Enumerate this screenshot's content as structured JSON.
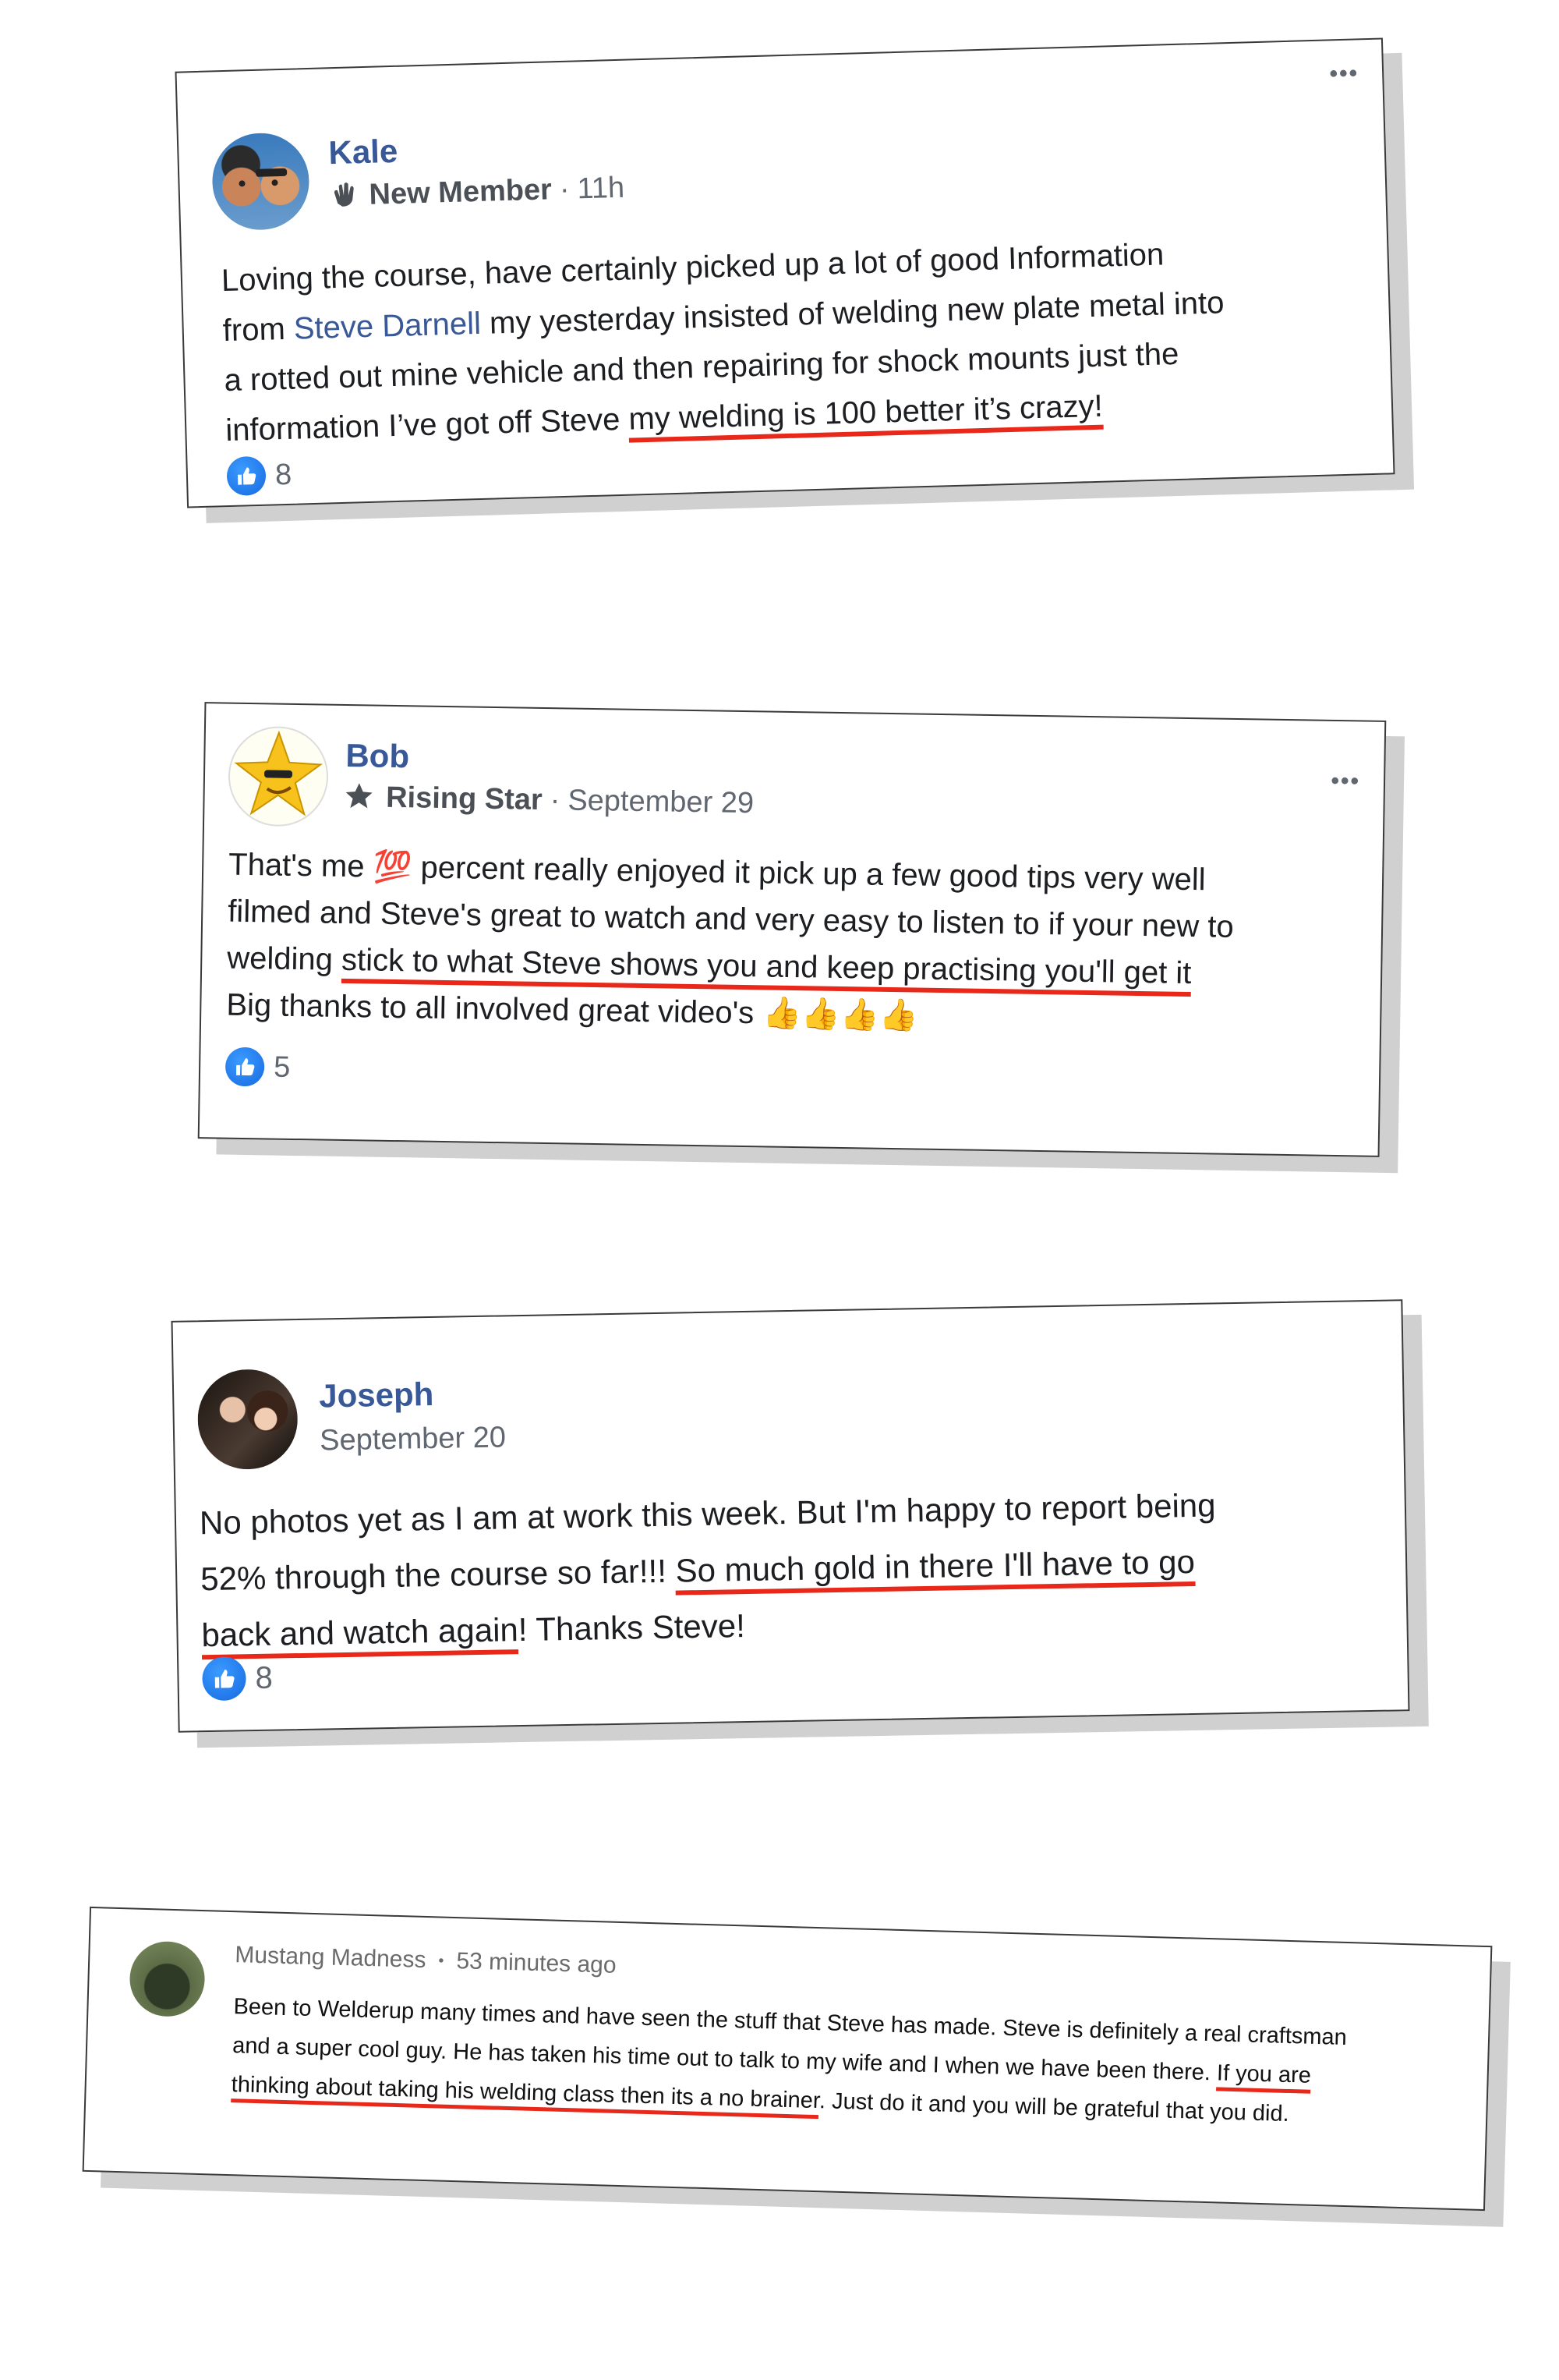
{
  "colors": {
    "name_link": "#385898",
    "underline": "#e8281a",
    "like_blue": "#1877f2"
  },
  "cards": [
    {
      "author": "Kale",
      "badge_icon": "wave-hand-icon",
      "badge": "New Member",
      "time": "11h",
      "lines": [
        "Loving the course, have certainly picked up a lot of good Information",
        {
          "pre": "from ",
          "link": "Steve Darnell",
          "post": " my yesterday insisted of welding new plate metal into"
        },
        "a rotted out mine vehicle and then repairing for shock mounts just the",
        {
          "pre": "information I’ve got off Steve ",
          "underlined": "my welding is 100 better it’s crazy!"
        }
      ],
      "like_count": "8",
      "more_label": "•••"
    },
    {
      "author": "Bob",
      "badge_icon": "star-badge-icon",
      "badge": "Rising Star",
      "time": "September 29",
      "lines": [
        {
          "pre": "That's me ",
          "emoji": "💯",
          "post": " percent really enjoyed it pick up a few good tips very well"
        },
        "filmed and Steve's great to watch and very easy to listen to if your new to",
        {
          "pre": "welding ",
          "underlined": "stick to what Steve shows you and keep practising you'll get it"
        },
        {
          "pre": "Big thanks to all involved great video's ",
          "emoji": "👍👍👍👍"
        }
      ],
      "like_count": "5",
      "more_label": "•••"
    },
    {
      "author": "Joseph",
      "time": "September 20",
      "lines": [
        "No photos yet as I am at work this week. But I'm happy to report being",
        {
          "pre": "52% through the course so far!!! ",
          "underlined": "So much gold in there I'll have to go"
        },
        {
          "underlined": "back and watch again",
          "post": "! Thanks Steve!"
        }
      ],
      "like_count": "8"
    },
    {
      "author": "Mustang Madness",
      "separator": "•",
      "time": "53 minutes ago",
      "lines": [
        "Been to Welderup many times and have seen the stuff that Steve has made. Steve is definitely a real craftsman",
        {
          "pre": "and a super cool guy. He has taken his time out to talk to my wife and I when we have been there. ",
          "underlined": "If you are"
        },
        {
          "underlined": "thinking about taking his welding class then its a no brainer",
          "post": ". Just do it and you will be grateful that you did."
        }
      ]
    }
  ]
}
